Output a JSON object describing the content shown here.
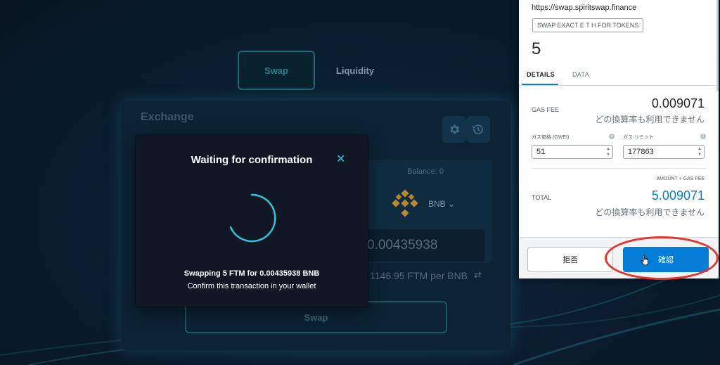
{
  "nav": {
    "swap_tab": "Swap",
    "liquidity_tab": "Liquidity"
  },
  "exchange": {
    "title": "Exchange",
    "balance": "Balance: 0",
    "token": "BNB",
    "amount": "0.00435938",
    "rate": "1146.95 FTM per BNB",
    "swap_button": "Swap"
  },
  "modal": {
    "title": "Waiting for confirmation",
    "swapping_text": "Swapping 5 FTM for 0.00435938 BNB",
    "confirm_text": "Confirm this transaction in your wallet"
  },
  "metamask": {
    "origin": "https://swap.spiritswap.finance",
    "method_badge": "SWAP EXACT E T H FOR TOKENS",
    "amount": "5",
    "tabs": [
      "DETAILS",
      "DATA"
    ],
    "gas_fee_label": "GAS FEE",
    "gas_fee_value": "0.009071",
    "no_conversion": "どの換算率も利用できません",
    "gas_price_label": "ガス価格 (GWEI)",
    "gas_price_value": "51",
    "gas_limit_label": "ガス リミット",
    "gas_limit_value": "177863",
    "amount_gas_fee_label": "AMOUNT + GAS FEE",
    "total_label": "TOTAL",
    "total_value": "5.009071",
    "reject_button": "拒否",
    "confirm_button": "確認"
  },
  "colors": {
    "accent_teal": "#2bc4d8",
    "metamask_blue": "#037dd6",
    "highlight_red": "#e8332a",
    "bnb_gold": "#b8862e"
  }
}
